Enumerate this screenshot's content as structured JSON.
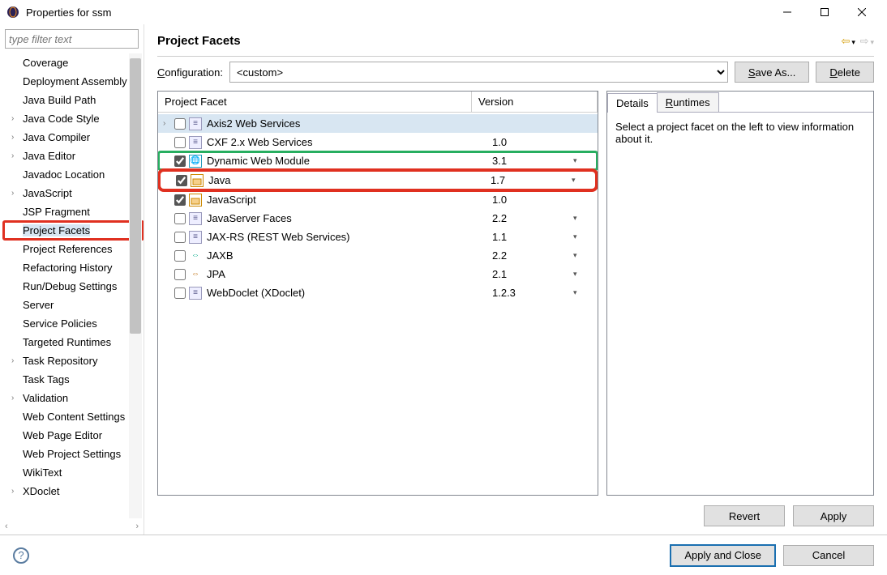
{
  "window": {
    "title": "Properties for ssm"
  },
  "sidebar": {
    "filter_placeholder": "type filter text",
    "items": [
      {
        "label": "Coverage",
        "exp": false
      },
      {
        "label": "Deployment Assembly",
        "exp": false
      },
      {
        "label": "Java Build Path",
        "exp": false
      },
      {
        "label": "Java Code Style",
        "exp": true
      },
      {
        "label": "Java Compiler",
        "exp": true
      },
      {
        "label": "Java Editor",
        "exp": true
      },
      {
        "label": "Javadoc Location",
        "exp": false
      },
      {
        "label": "JavaScript",
        "exp": true
      },
      {
        "label": "JSP Fragment",
        "exp": false
      },
      {
        "label": "Project Facets",
        "exp": false,
        "selected": true
      },
      {
        "label": "Project References",
        "exp": false
      },
      {
        "label": "Refactoring History",
        "exp": false
      },
      {
        "label": "Run/Debug Settings",
        "exp": false
      },
      {
        "label": "Server",
        "exp": false
      },
      {
        "label": "Service Policies",
        "exp": false
      },
      {
        "label": "Targeted Runtimes",
        "exp": false
      },
      {
        "label": "Task Repository",
        "exp": true
      },
      {
        "label": "Task Tags",
        "exp": false
      },
      {
        "label": "Validation",
        "exp": true
      },
      {
        "label": "Web Content Settings",
        "exp": false
      },
      {
        "label": "Web Page Editor",
        "exp": false
      },
      {
        "label": "Web Project Settings",
        "exp": false
      },
      {
        "label": "WikiText",
        "exp": false
      },
      {
        "label": "XDoclet",
        "exp": true
      }
    ]
  },
  "content": {
    "heading": "Project Facets",
    "config_label": "Configuration:",
    "config_value": "<custom>",
    "save_as": "Save As...",
    "delete": "Delete",
    "col_name": "Project Facet",
    "col_version": "Version",
    "facets": [
      {
        "name": "Axis2 Web Services",
        "version": "",
        "checked": false,
        "exp": true,
        "icon": "doc",
        "drop": false,
        "sel": true
      },
      {
        "name": "CXF 2.x Web Services",
        "version": "1.0",
        "checked": false,
        "icon": "doc",
        "drop": false
      },
      {
        "name": "Dynamic Web Module",
        "version": "3.1",
        "checked": true,
        "icon": "web",
        "drop": true,
        "hl": "green"
      },
      {
        "name": "Java",
        "version": "1.7",
        "checked": true,
        "icon": "java",
        "drop": true,
        "hl": "red"
      },
      {
        "name": "JavaScript",
        "version": "1.0",
        "checked": true,
        "icon": "java",
        "drop": false
      },
      {
        "name": "JavaServer Faces",
        "version": "2.2",
        "checked": false,
        "icon": "doc",
        "drop": true
      },
      {
        "name": "JAX-RS (REST Web Services)",
        "version": "1.1",
        "checked": false,
        "icon": "doc",
        "drop": true
      },
      {
        "name": "JAXB",
        "version": "2.2",
        "checked": false,
        "icon": "jaxb",
        "drop": true
      },
      {
        "name": "JPA",
        "version": "2.1",
        "checked": false,
        "icon": "jpa",
        "drop": true
      },
      {
        "name": "WebDoclet (XDoclet)",
        "version": "1.2.3",
        "checked": false,
        "icon": "doc",
        "drop": true
      }
    ],
    "tabs": {
      "details": "Details",
      "runtimes": "Runtimes"
    },
    "detail_text": "Select a project facet on the left to view information about it.",
    "revert": "Revert",
    "apply": "Apply"
  },
  "footer": {
    "apply_close": "Apply and Close",
    "cancel": "Cancel"
  }
}
